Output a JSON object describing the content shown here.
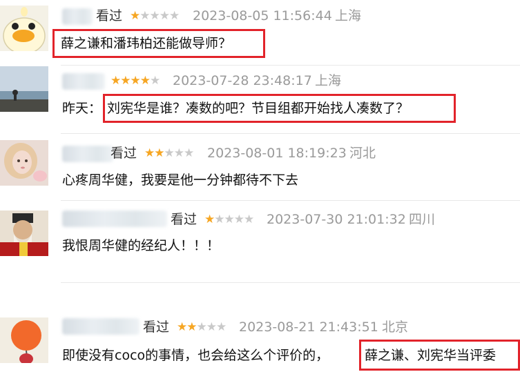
{
  "seen_label": "看过",
  "comments": [
    {
      "rating": 1,
      "time": "2023-08-05 11:56:44",
      "location": "上海",
      "text_prefix": "",
      "highlight": "薛之谦和潘玮柏还能做导师？"
    },
    {
      "rating": 4,
      "time": "2023-07-28 23:48:17",
      "location": "上海",
      "text_prefix": "昨天：",
      "highlight": "刘宪华是谁？凑数的吧？节目组都开始找人凑数了？"
    },
    {
      "rating": 2,
      "time": "2023-08-01 18:19:23",
      "location": "河北",
      "text_prefix": "心疼周华健，我要是他一分钟都待不下去",
      "highlight": ""
    },
    {
      "rating": 1,
      "time": "2023-07-30 21:01:32",
      "location": "四川",
      "text_prefix": "我恨周华健的经纪人！！！",
      "highlight": ""
    },
    {
      "rating": 2,
      "time": "2023-08-21 21:43:51",
      "location": "北京",
      "text_prefix": "即使没有coco的事情，也会给这么个评价的，",
      "highlight": "薛之谦、刘宪华当评委"
    }
  ],
  "colors": {
    "star_on": "#f6a623",
    "star_off": "#c9c9c9",
    "highlight_border": "#e2232a",
    "meta": "#9a9a9a"
  },
  "icons": [
    "duck-avatar",
    "seaside-avatar",
    "girl-avatar",
    "elder-avatar",
    "balloon-avatar",
    "star-icon"
  ]
}
